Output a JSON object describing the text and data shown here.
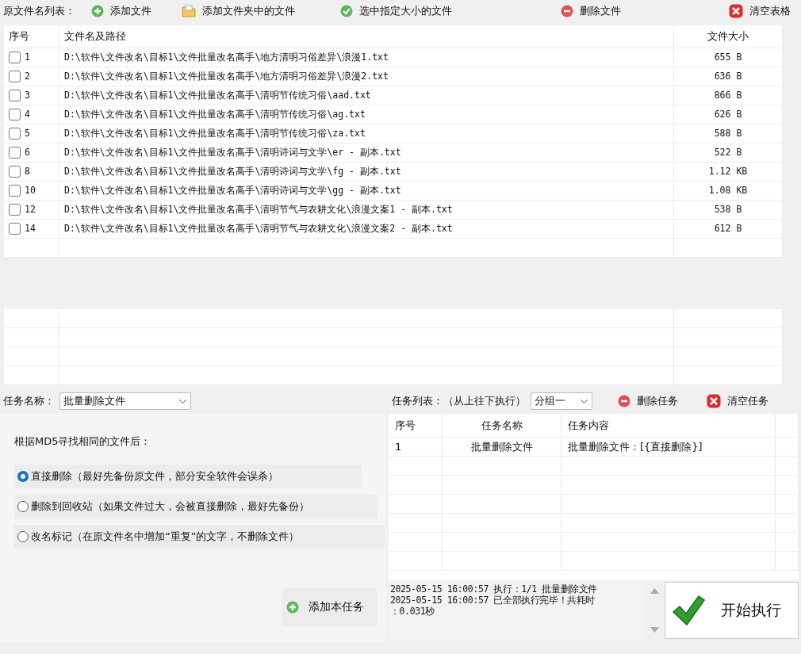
{
  "toolbar": {
    "label": "原文件名列表：",
    "buttons": [
      {
        "kind": "add",
        "label": "添加文件"
      },
      {
        "kind": "folder",
        "label": "添加文件夹中的文件"
      },
      {
        "kind": "check",
        "label": "选中指定大小的文件"
      },
      {
        "kind": "remove",
        "label": "删除文件"
      },
      {
        "kind": "clear",
        "label": "清空表格"
      }
    ]
  },
  "file_table": {
    "columns": [
      "序号",
      "文件名及路径",
      "文件大小"
    ],
    "rows": [
      {
        "checked": false,
        "index": "1",
        "path": "D:\\软件\\文件改名\\目标1\\文件批量改名高手\\地方清明习俗差异\\浪漫1.txt",
        "size": "655 B"
      },
      {
        "checked": false,
        "index": "2",
        "path": "D:\\软件\\文件改名\\目标1\\文件批量改名高手\\地方清明习俗差异\\浪漫2.txt",
        "size": "636 B"
      },
      {
        "checked": false,
        "index": "3",
        "path": "D:\\软件\\文件改名\\目标1\\文件批量改名高手\\清明节传统习俗\\aad.txt",
        "size": "866 B"
      },
      {
        "checked": false,
        "index": "4",
        "path": "D:\\软件\\文件改名\\目标1\\文件批量改名高手\\清明节传统习俗\\ag.txt",
        "size": "626 B"
      },
      {
        "checked": false,
        "index": "5",
        "path": "D:\\软件\\文件改名\\目标1\\文件批量改名高手\\清明节传统习俗\\za.txt",
        "size": "588 B"
      },
      {
        "checked": false,
        "index": "6",
        "path": "D:\\软件\\文件改名\\目标1\\文件批量改名高手\\清明诗词与文学\\er - 副本.txt",
        "size": "522 B"
      },
      {
        "checked": false,
        "index": "8",
        "path": "D:\\软件\\文件改名\\目标1\\文件批量改名高手\\清明诗词与文学\\fg - 副本.txt",
        "size": "1.12 KB"
      },
      {
        "checked": false,
        "index": "10",
        "path": "D:\\软件\\文件改名\\目标1\\文件批量改名高手\\清明诗词与文学\\gg - 副本.txt",
        "size": "1.08 KB"
      },
      {
        "checked": false,
        "index": "12",
        "path": "D:\\软件\\文件改名\\目标1\\文件批量改名高手\\清明节气与农耕文化\\浪漫文案1 - 副本.txt",
        "size": "538 B"
      },
      {
        "checked": false,
        "index": "14",
        "path": "D:\\软件\\文件改名\\目标1\\文件批量改名高手\\清明节气与农耕文化\\浪漫文案2 - 副本.txt",
        "size": "612 B"
      }
    ]
  },
  "task_name": {
    "label": "任务名称：",
    "value": "批量删除文件"
  },
  "options": {
    "heading": "根据MD5寻找相同的文件后：",
    "items": [
      {
        "label": "直接删除（最好先备份原文件，部分安全软件会误杀）",
        "selected": true
      },
      {
        "label": "删除到回收站（如果文件过大，会被直接删除，最好先备份）",
        "selected": false
      },
      {
        "label": "改名标记（在原文件名中增加“重复”的文字，不删除文件）",
        "selected": false
      }
    ]
  },
  "add_task_button": {
    "label": "添加本任务"
  },
  "task_list": {
    "label": "任务列表：（从上往下执行）",
    "group": "分组一",
    "buttons": [
      {
        "kind": "remove",
        "label": "删除任务"
      },
      {
        "kind": "clear",
        "label": "清空任务"
      }
    ],
    "columns": [
      "序号",
      "任务名称",
      "任务内容"
    ],
    "rows": [
      {
        "index": "1",
        "name": "批量删除文件",
        "content": "批量删除文件：[{直接删除}]"
      }
    ]
  },
  "log": [
    "2025-05-15 16:00:57 执行：1/1 批量删除文件",
    "2025-05-15 16:00:57 已全部执行完毕！共耗时",
    "：0.031秒"
  ],
  "start_button": {
    "label": "开始执行"
  }
}
